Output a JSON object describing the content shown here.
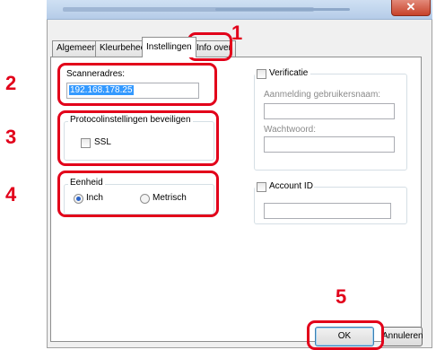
{
  "window": {
    "close_glyph": "✕"
  },
  "tabs": [
    {
      "label": "Algemeen"
    },
    {
      "label": "Kleurbehee"
    },
    {
      "label": "Instellingen"
    },
    {
      "label": "Info over"
    }
  ],
  "scanner": {
    "label": "Scanneradres:",
    "value": "192.168.178.25"
  },
  "protocol": {
    "group_title": "Protocolinstellingen beveiligen",
    "ssl_label": "SSL",
    "ssl_checked": false
  },
  "unit": {
    "group_title": "Eenheid",
    "inch_label": "Inch",
    "metric_label": "Metrisch",
    "selected": "Inch"
  },
  "verification": {
    "label": "Verificatie",
    "checked": false,
    "username_label": "Aanmelding gebruikersnaam:",
    "password_label": "Wachtwoord:"
  },
  "account": {
    "label": "Account ID",
    "checked": false
  },
  "buttons": {
    "ok": "OK",
    "cancel": "Annuleren"
  },
  "callouts": [
    "1",
    "2",
    "3",
    "4",
    "5"
  ],
  "colors": {
    "callout": "#e2001a",
    "accent": "#3c7fb1"
  }
}
